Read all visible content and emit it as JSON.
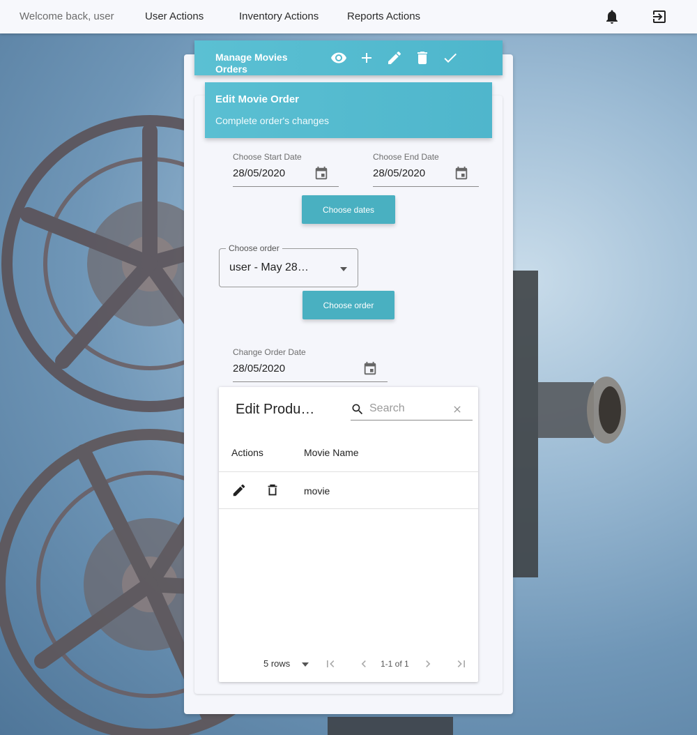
{
  "topbar": {
    "welcome": "Welcome back, user",
    "nav": [
      "User Actions",
      "Inventory Actions",
      "Reports Actions"
    ],
    "icons": [
      "bell-icon",
      "logout-icon"
    ]
  },
  "toolbar": {
    "title": "Manage Movies Orders",
    "actions": [
      "eye-icon",
      "plus-icon",
      "pencil-icon",
      "trash-icon",
      "check-icon"
    ]
  },
  "header": {
    "title": "Edit Movie Order",
    "subtitle": "Complete order's changes"
  },
  "dates": {
    "start_label": "Choose Start Date",
    "start_value": "28/05/2020",
    "end_label": "Choose End Date",
    "end_value": "28/05/2020",
    "button": "Choose dates"
  },
  "order": {
    "label": "Choose order",
    "value": "user - May 28…",
    "button": "Choose order"
  },
  "change_date": {
    "label": "Change Order Date",
    "value": "28/05/2020"
  },
  "table": {
    "title": "Edit Produ…",
    "search_placeholder": "Search",
    "columns": [
      "Actions",
      "Movie Name"
    ],
    "rows": [
      {
        "movie_name": "movie"
      }
    ],
    "pagination": {
      "rows_per_page": "5 rows",
      "range": "1-1 of 1"
    }
  },
  "colors": {
    "accent": "#49b0c1",
    "header": "#5abfd2",
    "topbar": "#f7f8fc",
    "card": "#f5f6fb"
  }
}
